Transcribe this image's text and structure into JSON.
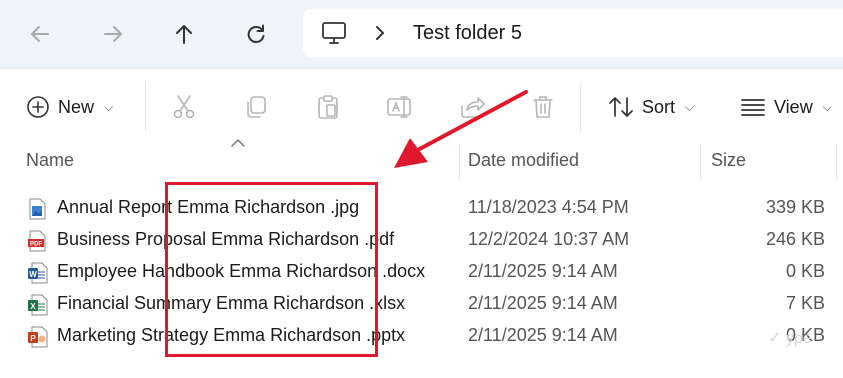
{
  "navigation": {
    "back_icon": "arrow-left-icon",
    "forward_icon": "arrow-right-icon",
    "up_icon": "arrow-up-icon",
    "refresh_icon": "refresh-icon"
  },
  "address": {
    "root_icon": "this-pc-icon",
    "separator": "›",
    "current_folder": "Test folder 5"
  },
  "toolbar": {
    "new_label": "New",
    "sort_label": "Sort",
    "view_label": "View",
    "icons": [
      "cut-icon",
      "copy-icon",
      "paste-icon",
      "rename-icon",
      "share-icon",
      "delete-icon"
    ]
  },
  "columns": {
    "name": "Name",
    "date_modified": "Date modified",
    "size": "Size"
  },
  "files": [
    {
      "name": "Annual Report Emma Richardson .jpg",
      "date": "11/18/2023 4:54 PM",
      "size": "339 KB",
      "type": "image"
    },
    {
      "name": "Business Proposal Emma Richardson .pdf",
      "date": "12/2/2024 10:37 AM",
      "size": "246 KB",
      "type": "pdf"
    },
    {
      "name": "Employee Handbook Emma Richardson .docx",
      "date": "2/11/2025 9:14 AM",
      "size": "0 KB",
      "type": "word"
    },
    {
      "name": "Financial Summary Emma Richardson .xlsx",
      "date": "2/11/2025 9:14 AM",
      "size": "7 KB",
      "type": "excel"
    },
    {
      "name": "Marketing Strategy Emma Richardson .pptx",
      "date": "2/11/2025 9:14 AM",
      "size": "0 KB",
      "type": "powerpoint"
    }
  ],
  "annotation_color": "#e0182d",
  "watermark_text": "✓ ype"
}
